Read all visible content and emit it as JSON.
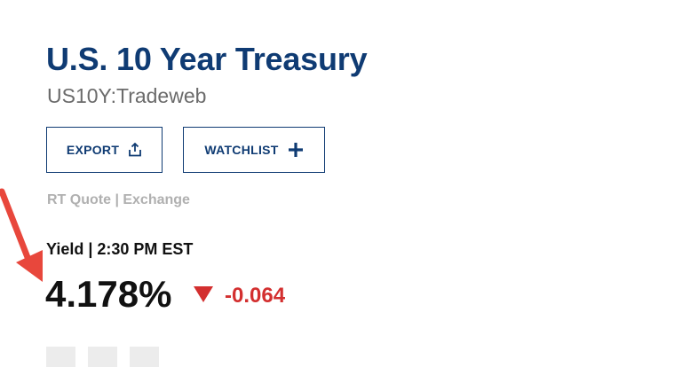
{
  "header": {
    "title": "U.S. 10 Year Treasury",
    "symbol": "US10Y:Tradeweb"
  },
  "actions": {
    "export_label": "EXPORT",
    "watchlist_label": "WATCHLIST"
  },
  "quote_source": "RT Quote | Exchange",
  "quote": {
    "yield_label": "Yield | 2:30 PM EST",
    "price": "4.178%",
    "change": "-0.064",
    "direction": "down"
  },
  "colors": {
    "brand": "#0f3b73",
    "negative": "#d32f2f",
    "annotation_arrow": "#e8473c"
  },
  "icons": {
    "export": "share-upload-icon",
    "watchlist": "plus-icon",
    "change": "triangle-down-icon",
    "annotation": "red-pointer-arrow-icon"
  }
}
